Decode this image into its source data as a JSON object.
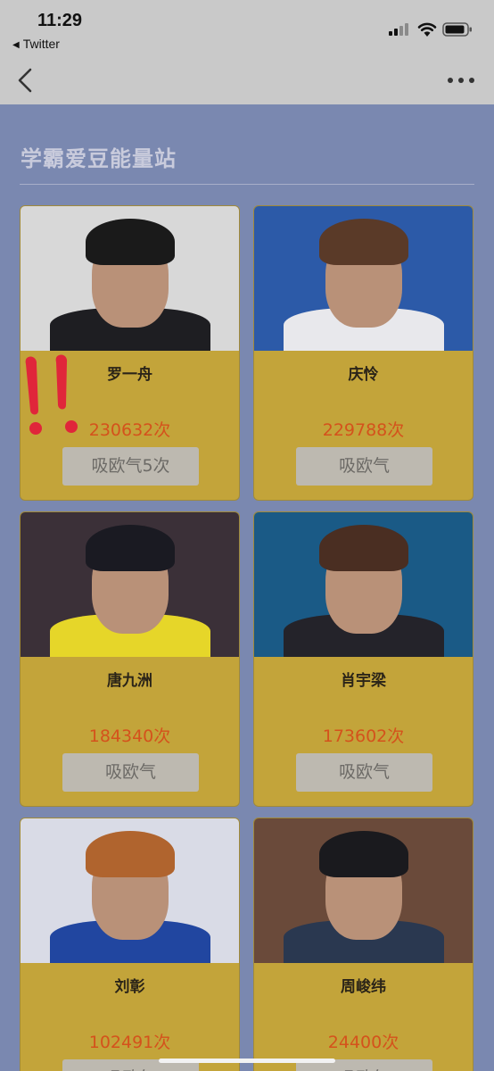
{
  "status_bar": {
    "time": "11:29",
    "back_app_label": "Twitter",
    "back_app_icon": "left-triangle-icon"
  },
  "nav": {
    "back_icon": "chevron-left-icon",
    "more_icon": "more-dots-icon"
  },
  "section": {
    "title": "学霸爱豆能量站"
  },
  "cards": [
    {
      "name": "罗一舟",
      "count": "230632次",
      "button": "吸欧气5次",
      "bg": "#d8d8d8",
      "hair": "#1a1a1a",
      "body": "#1e1e22"
    },
    {
      "name": "庆怜",
      "count": "229788次",
      "button": "吸欧气",
      "bg": "#2c5aa8",
      "hair": "#5a3a28",
      "body": "#e8e8ec"
    },
    {
      "name": "唐九洲",
      "count": "184340次",
      "button": "吸欧气",
      "bg": "#3b3038",
      "hair": "#1a1a22",
      "body": "#e6d629"
    },
    {
      "name": "肖宇梁",
      "count": "173602次",
      "button": "吸欧气",
      "bg": "#1a5a86",
      "hair": "#4a2e22",
      "body": "#24232a"
    },
    {
      "name": "刘彰",
      "count": "102491次",
      "button": "吸欧气",
      "bg": "#d9dbe6",
      "hair": "#b0642e",
      "body": "#2146a0"
    },
    {
      "name": "周峻纬",
      "count": "24400次",
      "button": "吸欧气",
      "bg": "#6a4a3a",
      "hair": "#1a1a1e",
      "body": "#2a3850"
    }
  ],
  "annotation": {
    "mark_color": "#e0263a"
  }
}
